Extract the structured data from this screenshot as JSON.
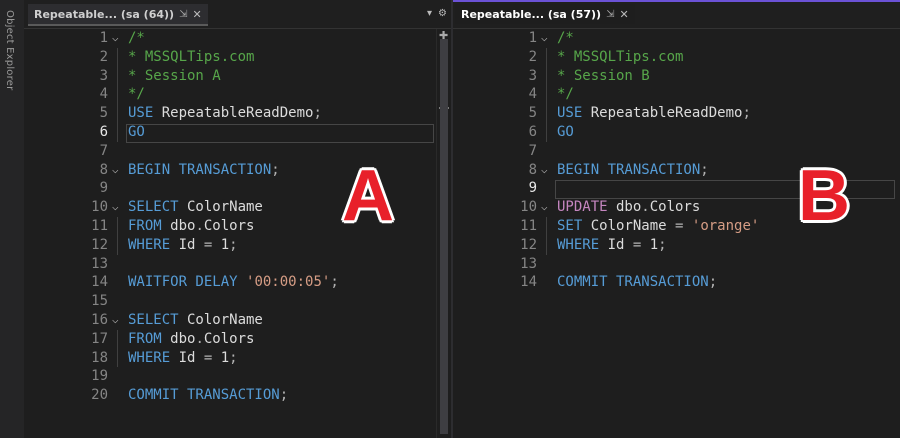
{
  "sidebar": {
    "label": "Object Explorer"
  },
  "tabs": {
    "a": {
      "title": "Repeatable... (sa (64))",
      "pin": "⇲",
      "close": "✕",
      "tools": [
        "▾",
        "⚙"
      ]
    },
    "b": {
      "title": "Repeatable... (sa (57))",
      "pin": "⇲",
      "close": "✕"
    }
  },
  "paneA": {
    "label": "A",
    "current_line": 6,
    "lines": [
      {
        "n": "1",
        "fold": "v",
        "tokens": [
          [
            "cm",
            "/*"
          ]
        ]
      },
      {
        "n": "2",
        "tokens": [
          [
            "cm",
            "* MSSQLTips.com"
          ]
        ]
      },
      {
        "n": "3",
        "tokens": [
          [
            "cm",
            "* Session A"
          ]
        ]
      },
      {
        "n": "4",
        "tokens": [
          [
            "cm",
            "*/"
          ]
        ]
      },
      {
        "n": "5",
        "tokens": [
          [
            "kw",
            "USE"
          ],
          [
            "tx",
            " RepeatableReadDemo"
          ],
          [
            "op",
            ";"
          ]
        ]
      },
      {
        "n": "6",
        "tokens": [
          [
            "kw",
            "GO"
          ]
        ]
      },
      {
        "n": "7",
        "tokens": []
      },
      {
        "n": "8",
        "fold": "v",
        "tokens": [
          [
            "kw",
            "BEGIN TRANSACTION"
          ],
          [
            "op",
            ";"
          ]
        ]
      },
      {
        "n": "9",
        "tokens": []
      },
      {
        "n": "10",
        "fold": "v",
        "tokens": [
          [
            "kw",
            "SELECT"
          ],
          [
            "tx",
            " ColorName"
          ]
        ]
      },
      {
        "n": "11",
        "tokens": [
          [
            "kw",
            "FROM"
          ],
          [
            "tx",
            " dbo"
          ],
          [
            "op",
            "."
          ],
          [
            "tx",
            "Colors"
          ]
        ]
      },
      {
        "n": "12",
        "tokens": [
          [
            "kw",
            "WHERE"
          ],
          [
            "tx",
            " Id "
          ],
          [
            "op",
            "="
          ],
          [
            "tx",
            " 1"
          ],
          [
            "op",
            ";"
          ]
        ]
      },
      {
        "n": "13",
        "tokens": []
      },
      {
        "n": "14",
        "tokens": [
          [
            "kw",
            "WAITFOR DELAY"
          ],
          [
            "tx",
            " "
          ],
          [
            "str",
            "'00:00:05'"
          ],
          [
            "op",
            ";"
          ]
        ]
      },
      {
        "n": "15",
        "tokens": []
      },
      {
        "n": "16",
        "fold": "v",
        "tokens": [
          [
            "kw",
            "SELECT"
          ],
          [
            "tx",
            " ColorName"
          ]
        ]
      },
      {
        "n": "17",
        "tokens": [
          [
            "kw",
            "FROM"
          ],
          [
            "tx",
            " dbo"
          ],
          [
            "op",
            "."
          ],
          [
            "tx",
            "Colors"
          ]
        ]
      },
      {
        "n": "18",
        "tokens": [
          [
            "kw",
            "WHERE"
          ],
          [
            "tx",
            " Id "
          ],
          [
            "op",
            "="
          ],
          [
            "tx",
            " 1"
          ],
          [
            "op",
            ";"
          ]
        ]
      },
      {
        "n": "19",
        "tokens": []
      },
      {
        "n": "20",
        "tokens": [
          [
            "kw",
            "COMMIT TRANSACTION"
          ],
          [
            "op",
            ";"
          ]
        ]
      }
    ]
  },
  "paneB": {
    "label": "B",
    "current_line": 9,
    "lines": [
      {
        "n": "1",
        "fold": "v",
        "tokens": [
          [
            "cm",
            "/*"
          ]
        ]
      },
      {
        "n": "2",
        "tokens": [
          [
            "cm",
            "* MSSQLTips.com"
          ]
        ]
      },
      {
        "n": "3",
        "tokens": [
          [
            "cm",
            "* Session B"
          ]
        ]
      },
      {
        "n": "4",
        "tokens": [
          [
            "cm",
            "*/"
          ]
        ]
      },
      {
        "n": "5",
        "tokens": [
          [
            "kw",
            "USE"
          ],
          [
            "tx",
            " RepeatableReadDemo"
          ],
          [
            "op",
            ";"
          ]
        ]
      },
      {
        "n": "6",
        "tokens": [
          [
            "kw",
            "GO"
          ]
        ]
      },
      {
        "n": "7",
        "tokens": []
      },
      {
        "n": "8",
        "fold": "v",
        "tokens": [
          [
            "kw",
            "BEGIN TRANSACTION"
          ],
          [
            "op",
            ";"
          ]
        ]
      },
      {
        "n": "9",
        "tokens": []
      },
      {
        "n": "10",
        "fold": "v",
        "tokens": [
          [
            "pur",
            "UPDATE"
          ],
          [
            "tx",
            " dbo"
          ],
          [
            "op",
            "."
          ],
          [
            "tx",
            "Colors"
          ]
        ]
      },
      {
        "n": "11",
        "tokens": [
          [
            "kw",
            "SET"
          ],
          [
            "tx",
            " ColorName "
          ],
          [
            "op",
            "="
          ],
          [
            "tx",
            " "
          ],
          [
            "str",
            "'orange'"
          ]
        ]
      },
      {
        "n": "12",
        "tokens": [
          [
            "kw",
            "WHERE"
          ],
          [
            "tx",
            " Id "
          ],
          [
            "op",
            "="
          ],
          [
            "tx",
            " 1"
          ],
          [
            "op",
            ";"
          ]
        ]
      },
      {
        "n": "13",
        "tokens": []
      },
      {
        "n": "14",
        "tokens": [
          [
            "kw",
            "COMMIT TRANSACTION"
          ],
          [
            "op",
            ";"
          ]
        ]
      }
    ]
  },
  "colors": {
    "keyword": "#569cd6",
    "comment": "#57a64a",
    "string": "#d69d85",
    "dml": "#c586c0",
    "accent": "#6b52d6",
    "label": "#e8202a"
  }
}
